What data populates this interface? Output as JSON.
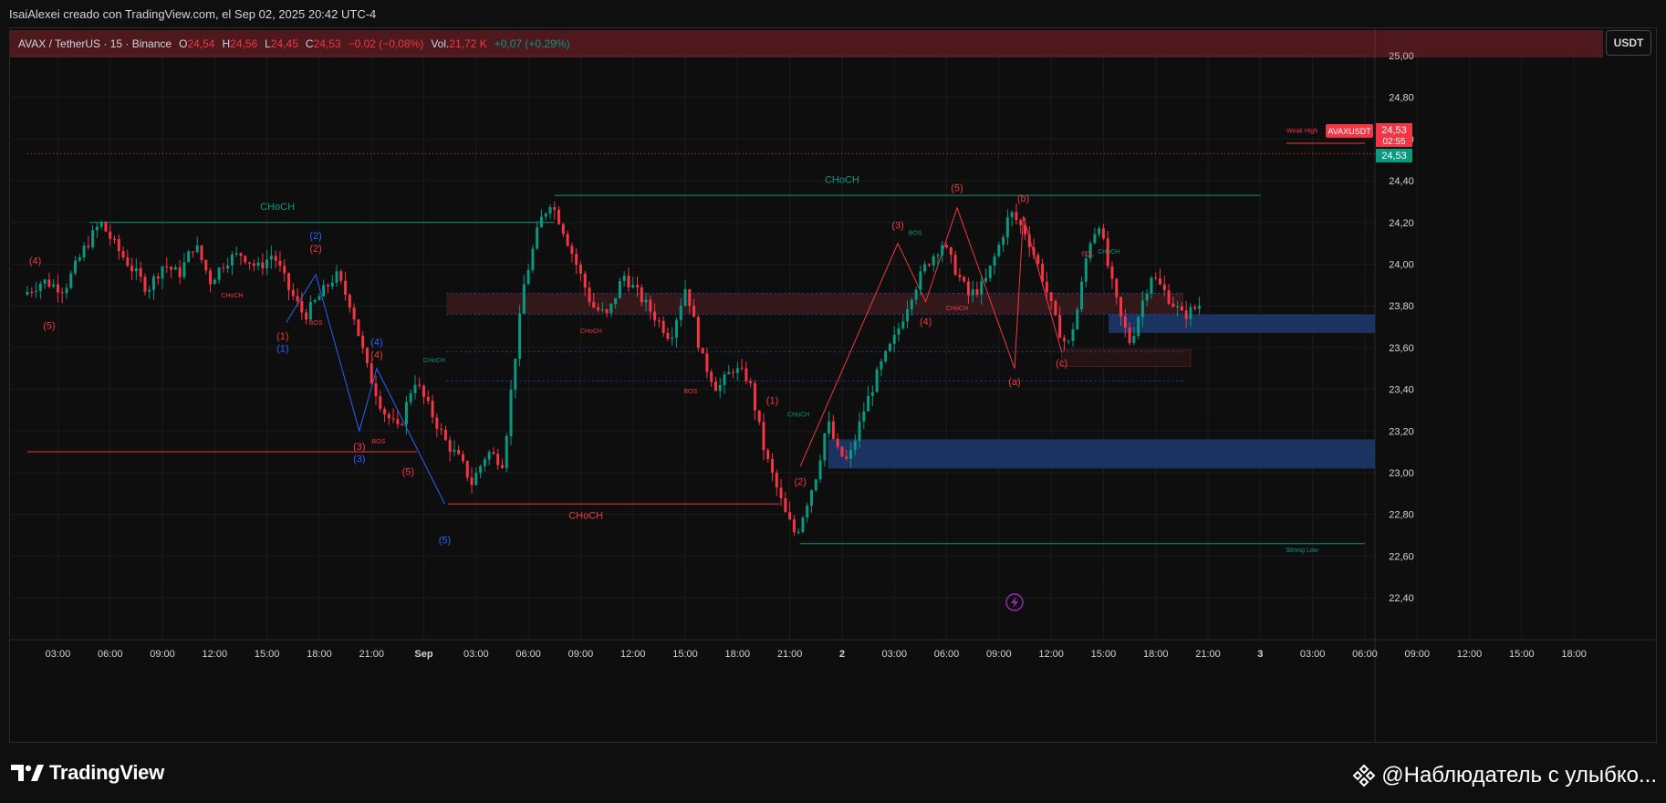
{
  "caption": "IsaiAlexei creado con TradingView.com, el Sep 02, 2025 20:42 UTC-4",
  "legend": {
    "title": "AVAX / TetherUS · 15 · Binance",
    "open_label": "O",
    "open": "24,54",
    "high_label": "H",
    "high": "24,56",
    "low_label": "L",
    "low": "24,45",
    "close_label": "C",
    "close": "24,53",
    "change": "−0,02 (−0,08%)",
    "vol_label": "Vol.",
    "vol": "21,72 K",
    "vol_change": "+0,07 (+0,29%)"
  },
  "currency_button": "USDT",
  "price_tags": {
    "symbol": "AVAXUSDT",
    "last_price": "24,53",
    "countdown": "02:55",
    "bid_price": "24,53"
  },
  "footer": {
    "logo_text": "TradingView",
    "watermark": "@Наблюдатель с улыбко..."
  },
  "colors": {
    "up": "#089981",
    "down": "#f23645",
    "blue_wave": "#2962ff",
    "zone_blue": "#172e55",
    "teal_line": "#089981",
    "background": "#0f0f0f"
  },
  "icons": [
    "tradingview-logo-icon",
    "lightning-icon",
    "binance-diamond-icon"
  ],
  "chart_data": {
    "type": "candlestick",
    "symbol": "AVAX / TetherUS",
    "timeframe": "15",
    "exchange": "Binance",
    "ylim": [
      22.3,
      25.0
    ],
    "y_ticks": [
      "25,00",
      "24,80",
      "24,60",
      "24,40",
      "24,20",
      "24,00",
      "23,80",
      "23,60",
      "23,40",
      "23,20",
      "23,00",
      "22,80",
      "22,60",
      "22,40"
    ],
    "y_tick_values": [
      25.0,
      24.8,
      24.6,
      24.4,
      24.2,
      24.0,
      23.8,
      23.6,
      23.4,
      23.2,
      23.0,
      22.8,
      22.6,
      22.4
    ],
    "x_ticks": [
      "03:00",
      "06:00",
      "09:00",
      "12:00",
      "15:00",
      "18:00",
      "21:00",
      "Sep",
      "03:00",
      "06:00",
      "09:00",
      "12:00",
      "15:00",
      "18:00",
      "21:00",
      "2",
      "03:00",
      "06:00",
      "09:00",
      "12:00",
      "15:00",
      "18:00",
      "21:00",
      "3",
      "03:00",
      "06:00",
      "09:00",
      "12:00",
      "15:00",
      "18:00"
    ],
    "x_tick_hours": [
      3,
      6,
      9,
      12,
      15,
      18,
      21,
      24,
      27,
      30,
      33,
      36,
      39,
      42,
      45,
      48,
      51,
      54,
      57,
      60,
      63,
      66,
      69,
      72,
      75,
      78,
      81,
      84,
      87,
      90
    ],
    "x_start_hour": 1.25,
    "x_end_hour": 92,
    "last_hour": 68.6,
    "price_path": [
      [
        1.2,
        23.85
      ],
      [
        2.4,
        23.92
      ],
      [
        3.6,
        23.88
      ],
      [
        4.8,
        24.08
      ],
      [
        5.7,
        24.2
      ],
      [
        6.6,
        24.08
      ],
      [
        7.5,
        23.98
      ],
      [
        8.4,
        23.88
      ],
      [
        9.3,
        24.0
      ],
      [
        10.2,
        23.95
      ],
      [
        11.1,
        24.1
      ],
      [
        12.0,
        23.92
      ],
      [
        12.9,
        24.02
      ],
      [
        13.8,
        24.05
      ],
      [
        14.7,
        23.98
      ],
      [
        15.6,
        24.05
      ],
      [
        16.5,
        23.88
      ],
      [
        17.4,
        23.75
      ],
      [
        18.3,
        23.85
      ],
      [
        19.2,
        23.95
      ],
      [
        20.1,
        23.8
      ],
      [
        21.0,
        23.5
      ],
      [
        21.9,
        23.3
      ],
      [
        22.8,
        23.2
      ],
      [
        23.7,
        23.45
      ],
      [
        24.6,
        23.3
      ],
      [
        25.5,
        23.15
      ],
      [
        26.4,
        23.05
      ],
      [
        27.0,
        22.95
      ],
      [
        27.9,
        23.1
      ],
      [
        28.8,
        23.05
      ],
      [
        29.4,
        23.5
      ],
      [
        30.0,
        23.9
      ],
      [
        30.9,
        24.2
      ],
      [
        31.5,
        24.3
      ],
      [
        32.1,
        24.2
      ],
      [
        33.0,
        24.0
      ],
      [
        33.9,
        23.8
      ],
      [
        34.8,
        23.75
      ],
      [
        35.7,
        23.95
      ],
      [
        36.6,
        23.85
      ],
      [
        37.5,
        23.75
      ],
      [
        38.4,
        23.65
      ],
      [
        39.3,
        23.9
      ],
      [
        40.2,
        23.55
      ],
      [
        41.1,
        23.4
      ],
      [
        42.0,
        23.5
      ],
      [
        42.9,
        23.45
      ],
      [
        43.8,
        23.1
      ],
      [
        44.4,
        22.95
      ],
      [
        45.0,
        22.8
      ],
      [
        45.6,
        22.7
      ],
      [
        46.2,
        22.85
      ],
      [
        46.8,
        23.0
      ],
      [
        47.4,
        23.25
      ],
      [
        48.0,
        23.1
      ],
      [
        48.6,
        23.05
      ],
      [
        49.5,
        23.3
      ],
      [
        50.4,
        23.5
      ],
      [
        51.3,
        23.65
      ],
      [
        52.2,
        23.85
      ],
      [
        53.1,
        24.0
      ],
      [
        54.0,
        24.1
      ],
      [
        54.6,
        24.0
      ],
      [
        55.5,
        23.85
      ],
      [
        56.4,
        23.9
      ],
      [
        57.3,
        24.1
      ],
      [
        57.9,
        24.25
      ],
      [
        58.8,
        24.15
      ],
      [
        59.7,
        23.95
      ],
      [
        60.6,
        23.7
      ],
      [
        61.2,
        23.6
      ],
      [
        61.8,
        23.8
      ],
      [
        62.4,
        24.1
      ],
      [
        63.0,
        24.2
      ],
      [
        63.6,
        23.95
      ],
      [
        64.2,
        23.75
      ],
      [
        64.8,
        23.62
      ],
      [
        65.4,
        23.8
      ],
      [
        66.0,
        23.95
      ],
      [
        66.9,
        23.85
      ],
      [
        67.8,
        23.75
      ],
      [
        68.7,
        23.8
      ],
      [
        69.3,
        23.85
      ],
      [
        70.2,
        24.0
      ],
      [
        71.1,
        24.15
      ],
      [
        72.0,
        24.3
      ],
      [
        72.9,
        24.45
      ],
      [
        73.5,
        24.5
      ],
      [
        74.1,
        24.53
      ]
    ],
    "horizontal_levels": [
      {
        "name": "last-price-line",
        "price": 24.53,
        "color": "#f23645",
        "style": "dotted"
      },
      {
        "name": "choch-level-left",
        "price": 24.2,
        "color": "#089981"
      },
      {
        "name": "choch-level-top",
        "price": 24.33,
        "color": "#089981"
      },
      {
        "name": "choch-level-bottom",
        "price": 22.85,
        "color": "#f23645"
      },
      {
        "name": "strong-low-level",
        "price": 22.66,
        "color": "#089981"
      },
      {
        "name": "weak-high-level",
        "price": 24.58,
        "color": "#f23645"
      },
      {
        "name": "left-red-support",
        "price": 23.1,
        "color": "#f23645"
      }
    ],
    "zones": [
      {
        "name": "upper-demand-zone",
        "price_top": 23.76,
        "price_bottom": 23.67,
        "color": "#1c3a6e"
      },
      {
        "name": "lower-demand-zone",
        "price_top": 23.16,
        "price_bottom": 23.02,
        "color": "#1c3a6e"
      },
      {
        "name": "supply-zone",
        "price_top": 23.86,
        "price_bottom": 23.76,
        "color": "#3a1a1c"
      },
      {
        "name": "small-red-box",
        "price_top": 23.59,
        "price_bottom": 23.51,
        "color": "#2a1416"
      }
    ],
    "annotations": [
      {
        "text": "(4)",
        "hour": 1.7,
        "price": 24.0,
        "color": "#f23645"
      },
      {
        "text": "(5)",
        "hour": 2.5,
        "price": 23.69,
        "color": "#f23645"
      },
      {
        "text": "CHoCH",
        "hour": 15.6,
        "price": 24.26,
        "color": "#089981"
      },
      {
        "text": "(2)",
        "hour": 17.8,
        "price": 24.12,
        "color": "#2962ff"
      },
      {
        "text": "(2)",
        "hour": 17.8,
        "price": 24.06,
        "color": "#f23645"
      },
      {
        "text": "CHoCH",
        "hour": 13.0,
        "price": 23.84,
        "color": "#f23645",
        "small": true
      },
      {
        "text": "BOS",
        "hour": 17.8,
        "price": 23.71,
        "color": "#f23645",
        "small": true
      },
      {
        "text": "(1)",
        "hour": 15.9,
        "price": 23.64,
        "color": "#f23645"
      },
      {
        "text": "(1)",
        "hour": 15.9,
        "price": 23.58,
        "color": "#2962ff"
      },
      {
        "text": "(4)",
        "hour": 21.3,
        "price": 23.61,
        "color": "#2962ff"
      },
      {
        "text": "(4)",
        "hour": 21.3,
        "price": 23.55,
        "color": "#f23645"
      },
      {
        "text": "CHoCH",
        "hour": 24.6,
        "price": 23.53,
        "color": "#089981",
        "small": true
      },
      {
        "text": "(3)",
        "hour": 20.3,
        "price": 23.11,
        "color": "#f23645"
      },
      {
        "text": "(3)",
        "hour": 20.3,
        "price": 23.05,
        "color": "#2962ff"
      },
      {
        "text": "BOS",
        "hour": 21.4,
        "price": 23.14,
        "color": "#f23645",
        "small": true
      },
      {
        "text": "(5)",
        "hour": 23.1,
        "price": 22.99,
        "color": "#f23645"
      },
      {
        "text": "(5)",
        "hour": 25.2,
        "price": 22.66,
        "color": "#2962ff"
      },
      {
        "text": "CHoCH",
        "hour": 33.3,
        "price": 22.78,
        "color": "#f23645"
      },
      {
        "text": "CHoCH",
        "hour": 33.6,
        "price": 23.67,
        "color": "#f23645",
        "small": true
      },
      {
        "text": "BOS",
        "hour": 39.3,
        "price": 23.38,
        "color": "#f23645",
        "small": true
      },
      {
        "text": "(1)",
        "hour": 44.0,
        "price": 23.33,
        "color": "#f23645"
      },
      {
        "text": "CHoCH",
        "hour": 45.5,
        "price": 23.27,
        "color": "#089981",
        "small": true
      },
      {
        "text": "(2)",
        "hour": 45.6,
        "price": 22.94,
        "color": "#f23645"
      },
      {
        "text": "CHoCH",
        "hour": 48.0,
        "price": 24.39,
        "color": "#089981"
      },
      {
        "text": "(3)",
        "hour": 51.2,
        "price": 24.17,
        "color": "#f23645"
      },
      {
        "text": "BOS",
        "hour": 52.2,
        "price": 24.14,
        "color": "#089981",
        "small": true
      },
      {
        "text": "(4)",
        "hour": 52.8,
        "price": 23.71,
        "color": "#f23645"
      },
      {
        "text": "(5)",
        "hour": 54.6,
        "price": 24.35,
        "color": "#f23645"
      },
      {
        "text": "CHoCH",
        "hour": 54.6,
        "price": 23.78,
        "color": "#f23645",
        "small": true
      },
      {
        "text": "(b)",
        "hour": 58.4,
        "price": 24.3,
        "color": "#f23645"
      },
      {
        "text": "(a)",
        "hour": 57.9,
        "price": 23.42,
        "color": "#f23645"
      },
      {
        "text": "(c)",
        "hour": 60.6,
        "price": 23.51,
        "color": "#f23645"
      },
      {
        "text": "EQL",
        "hour": 62.1,
        "price": 24.04,
        "color": "#f23645",
        "small": true
      },
      {
        "text": "CHoCH",
        "hour": 63.3,
        "price": 24.05,
        "color": "#089981",
        "small": true
      },
      {
        "text": "Weak High",
        "hour": 74.4,
        "price": 24.63,
        "color": "#f23645",
        "small": true
      },
      {
        "text": "Strong Low",
        "hour": 74.4,
        "price": 22.62,
        "color": "#089981",
        "small": true
      }
    ]
  }
}
